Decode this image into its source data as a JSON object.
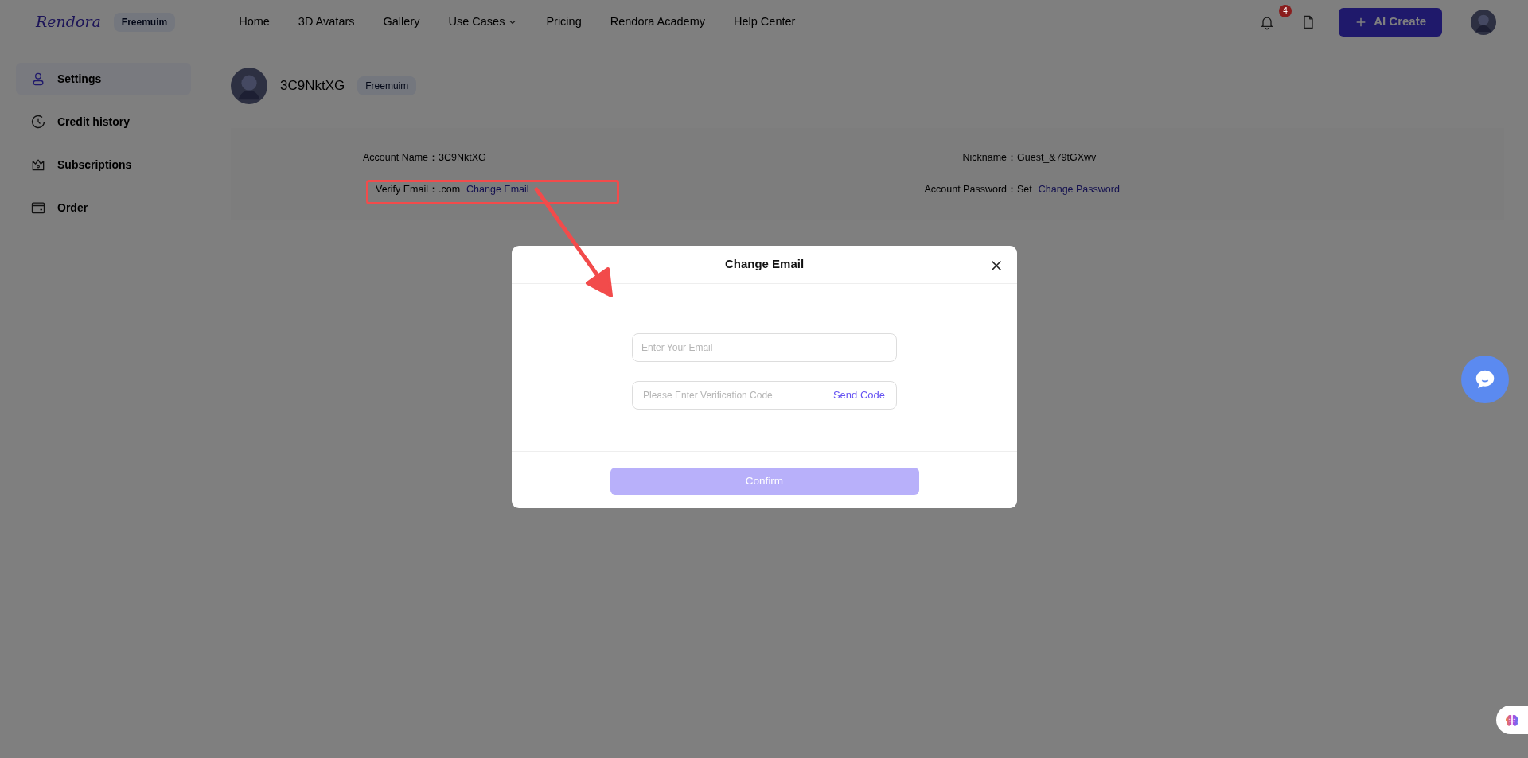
{
  "brand": {
    "logo": "Rendora",
    "plan_badge": "Freemuim"
  },
  "nav": [
    {
      "label": "Home",
      "dropdown": false
    },
    {
      "label": "3D Avatars",
      "dropdown": false
    },
    {
      "label": "Gallery",
      "dropdown": false
    },
    {
      "label": "Use Cases",
      "dropdown": true
    },
    {
      "label": "Pricing",
      "dropdown": false
    },
    {
      "label": "Rendora Academy",
      "dropdown": false
    },
    {
      "label": "Help Center",
      "dropdown": false
    }
  ],
  "notifications": {
    "count": "4"
  },
  "create_button": "AI Create",
  "sidebar": [
    {
      "label": "Settings",
      "kind": "user",
      "selected": true
    },
    {
      "label": "Credit history",
      "kind": "clock",
      "selected": false
    },
    {
      "label": "Subscriptions",
      "kind": "crown",
      "selected": false
    },
    {
      "label": "Order",
      "kind": "wallet",
      "selected": false
    }
  ],
  "profile": {
    "username": "3C9NktXG",
    "plan_badge": "Freemuim"
  },
  "account": [
    {
      "label": "Account Name：",
      "value": "3C9NktXG"
    },
    {
      "label": "Nickname：",
      "value": "Guest_&79tGXwv"
    },
    {
      "label": "Verify Email：",
      "value": ".com",
      "link": "Change Email"
    },
    {
      "label": "Account Password：",
      "value": "Set",
      "link": "Change Password"
    }
  ],
  "modal": {
    "title": "Change Email",
    "email_placeholder": "Enter Your Email",
    "code_placeholder": "Please Enter Verification Code",
    "send_code": "Send Code",
    "confirm": {
      "label": "Confirm",
      "disabled": true
    }
  }
}
